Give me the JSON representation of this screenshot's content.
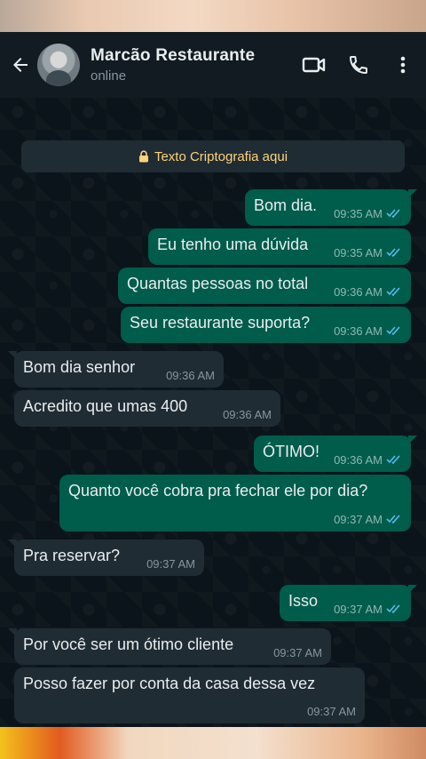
{
  "header": {
    "contact_name": "Marcão Restaurante",
    "status": "online"
  },
  "encryption_notice": "Texto Criptografia aqui",
  "messages": [
    {
      "dir": "out",
      "text": "Bom dia.",
      "time": "09:35 AM"
    },
    {
      "dir": "out",
      "text": "Eu tenho uma dúvida",
      "time": "09:35 AM"
    },
    {
      "dir": "out",
      "text": "Quantas pessoas no total",
      "time": "09:36 AM"
    },
    {
      "dir": "out",
      "text": "Seu restaurante suporta?",
      "time": "09:36 AM"
    },
    {
      "dir": "in",
      "text": "Bom dia senhor",
      "time": "09:36 AM"
    },
    {
      "dir": "in",
      "text": "Acredito que umas 400",
      "time": "09:36 AM"
    },
    {
      "dir": "out",
      "text": "ÓTIMO!",
      "time": "09:36 AM"
    },
    {
      "dir": "out",
      "text": "Quanto você cobra pra fechar ele por dia?",
      "time": "09:37 AM"
    },
    {
      "dir": "in",
      "text": "Pra reservar?",
      "time": "09:37 AM"
    },
    {
      "dir": "out",
      "text": "Isso",
      "time": "09:37 AM"
    },
    {
      "dir": "in",
      "text": "Por você ser um ótimo cliente",
      "time": "09:37 AM"
    },
    {
      "dir": "in",
      "text": "Posso fazer por conta da casa dessa vez",
      "time": "09:37 AM"
    }
  ],
  "colors": {
    "outgoing_bubble": "#005c4b",
    "incoming_bubble": "#202c33",
    "header_bg": "#111b21",
    "chat_bg": "#0b141a",
    "read_ticks": "#53bdeb",
    "notice_text": "#ffd279"
  },
  "icons": [
    "back-arrow-icon",
    "video-call-icon",
    "phone-icon",
    "more-options-icon",
    "lock-icon",
    "double-check-icon"
  ]
}
